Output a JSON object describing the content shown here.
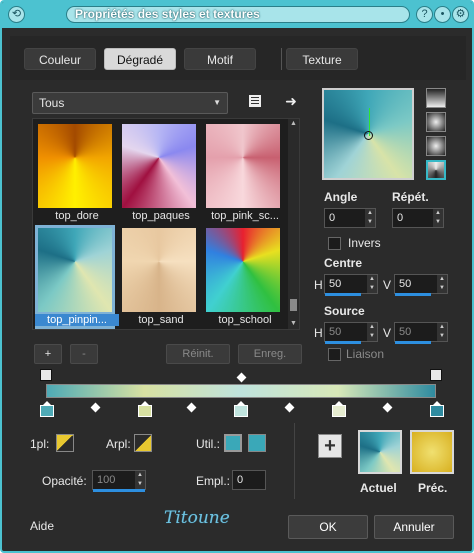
{
  "window": {
    "title": "Propriétés des styles et textures",
    "help_icon": "?"
  },
  "tabs": [
    {
      "label": "Couleur"
    },
    {
      "label": "Dégradé"
    },
    {
      "label": "Motif"
    },
    {
      "label": "Texture"
    }
  ],
  "category_select": {
    "value": "Tous"
  },
  "gallery": {
    "items": [
      {
        "label": "top_dore"
      },
      {
        "label": "top_paques"
      },
      {
        "label": "top_pink_sc..."
      },
      {
        "label": "top_pinpin..."
      },
      {
        "label": "top_sand"
      },
      {
        "label": "top_school"
      }
    ]
  },
  "gallery_buttons": {
    "add": "+",
    "remove": "-",
    "reset": "Réinit.",
    "save": "Enreg."
  },
  "gradient": {
    "angle_label": "Angle",
    "angle_value": "0",
    "repeat_label": "Répét.",
    "repeat_value": "0",
    "invert_label": "Invers",
    "center_label": "Centre",
    "center_h_label": "H",
    "center_h": "50",
    "center_v_label": "V",
    "center_v": "50",
    "source_label": "Source",
    "source_h_label": "H",
    "source_h": "50",
    "source_v_label": "V",
    "source_v": "50",
    "link_label": "Liaison"
  },
  "editor": {
    "fg_label": "1pl:",
    "bg_label": "Arpl:",
    "user_label": "Util.:",
    "opacity_label": "Opacité:",
    "opacity_value": "100",
    "location_label": "Empl.:",
    "location_value": "0"
  },
  "swatches": {
    "current_label": "Actuel",
    "previous_label": "Préc."
  },
  "bottom": {
    "help": "Aide",
    "signature": "Titoune",
    "ok": "OK",
    "cancel": "Annuler"
  },
  "colors": {
    "title_bar": "#4cc2d0",
    "selection": "#3a88d0",
    "dialog_bg": "#2b2b2b"
  }
}
